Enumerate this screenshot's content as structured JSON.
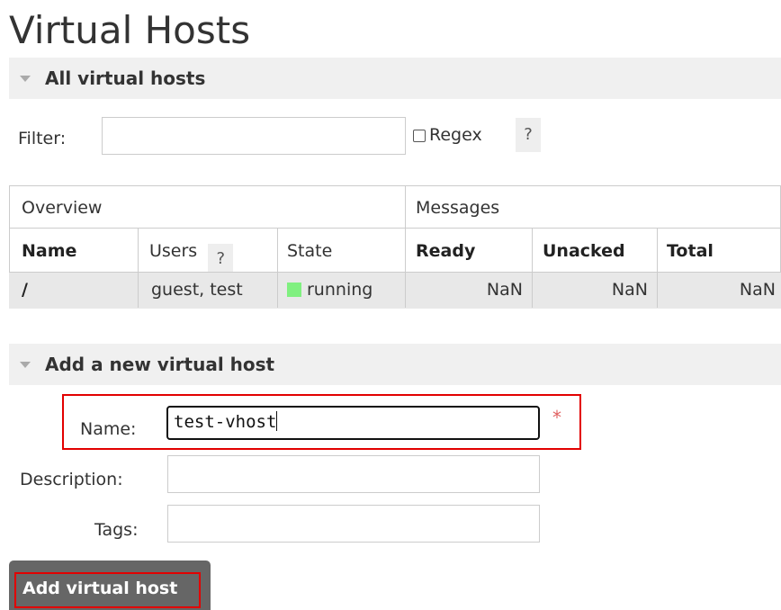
{
  "page": {
    "title": "Virtual Hosts"
  },
  "all_vhosts": {
    "section_title": "All virtual hosts",
    "filter_label": "Filter:",
    "filter_value": "",
    "regex_label": "Regex",
    "regex_checked": false,
    "help_label": "?"
  },
  "table": {
    "group_overview": "Overview",
    "group_messages": "Messages",
    "columns": {
      "name": "Name",
      "users": "Users",
      "users_help": "?",
      "state": "State",
      "ready": "Ready",
      "unacked": "Unacked",
      "total": "Total"
    },
    "rows": [
      {
        "name": "/",
        "users": "guest, test",
        "state": "running",
        "state_color": "#80f080",
        "ready": "NaN",
        "unacked": "NaN",
        "total": "NaN"
      }
    ]
  },
  "add_vhost": {
    "section_title": "Add a new virtual host",
    "name_label": "Name:",
    "name_value": "test-vhost",
    "required_mark": "*",
    "description_label": "Description:",
    "description_value": "",
    "tags_label": "Tags:",
    "tags_value": "",
    "submit_label": "Add virtual host"
  },
  "colors": {
    "highlight": "#e20000",
    "running": "#80f080",
    "button": "#666666"
  }
}
